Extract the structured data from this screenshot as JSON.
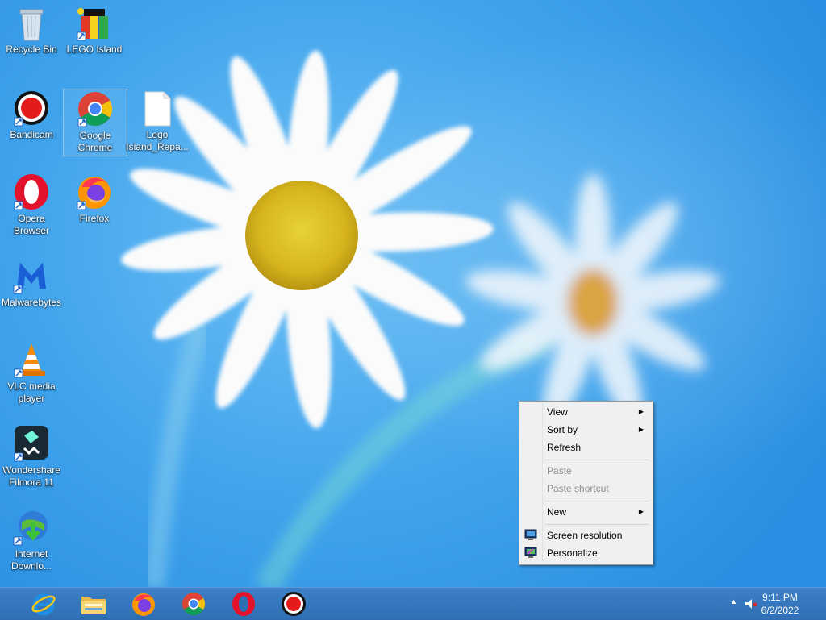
{
  "desktop_icons": [
    {
      "label": "Recycle Bin"
    },
    {
      "label": "LEGO Island"
    },
    {
      "label": "Bandicam"
    },
    {
      "label": "Google Chrome"
    },
    {
      "label": "Lego Island_Repa..."
    },
    {
      "label": "Opera Browser"
    },
    {
      "label": "Firefox"
    },
    {
      "label": "Malwarebytes"
    },
    {
      "label": "VLC media player"
    },
    {
      "label": "Wondershare Filmora 11"
    },
    {
      "label": "Internet Downlo..."
    }
  ],
  "context_menu": {
    "items": [
      {
        "label": "View",
        "submenu": true
      },
      {
        "label": "Sort by",
        "submenu": true
      },
      {
        "label": "Refresh"
      },
      {
        "label": "Paste",
        "disabled": true
      },
      {
        "label": "Paste shortcut",
        "disabled": true
      },
      {
        "label": "New",
        "submenu": true
      },
      {
        "label": "Screen resolution",
        "icon": "screen-resolution-icon"
      },
      {
        "label": "Personalize",
        "icon": "personalize-icon"
      }
    ],
    "submenu_arrow": "▶"
  },
  "taskbar": {
    "pinned": [
      {
        "icon": "internet-explorer-icon"
      },
      {
        "icon": "file-explorer-icon"
      },
      {
        "icon": "firefox-icon"
      },
      {
        "icon": "chrome-icon"
      },
      {
        "icon": "opera-icon"
      },
      {
        "icon": "bandicam-icon"
      }
    ],
    "tray": {
      "show_hidden_arrow": "▲",
      "volume_icon": "volume-muted-icon",
      "time": "9:11 PM",
      "date": "6/2/2022"
    }
  },
  "colors": {
    "wallpaper": "#3fa3ec",
    "taskbar": "#3476bd",
    "menu_bg": "#f0f0f0"
  }
}
